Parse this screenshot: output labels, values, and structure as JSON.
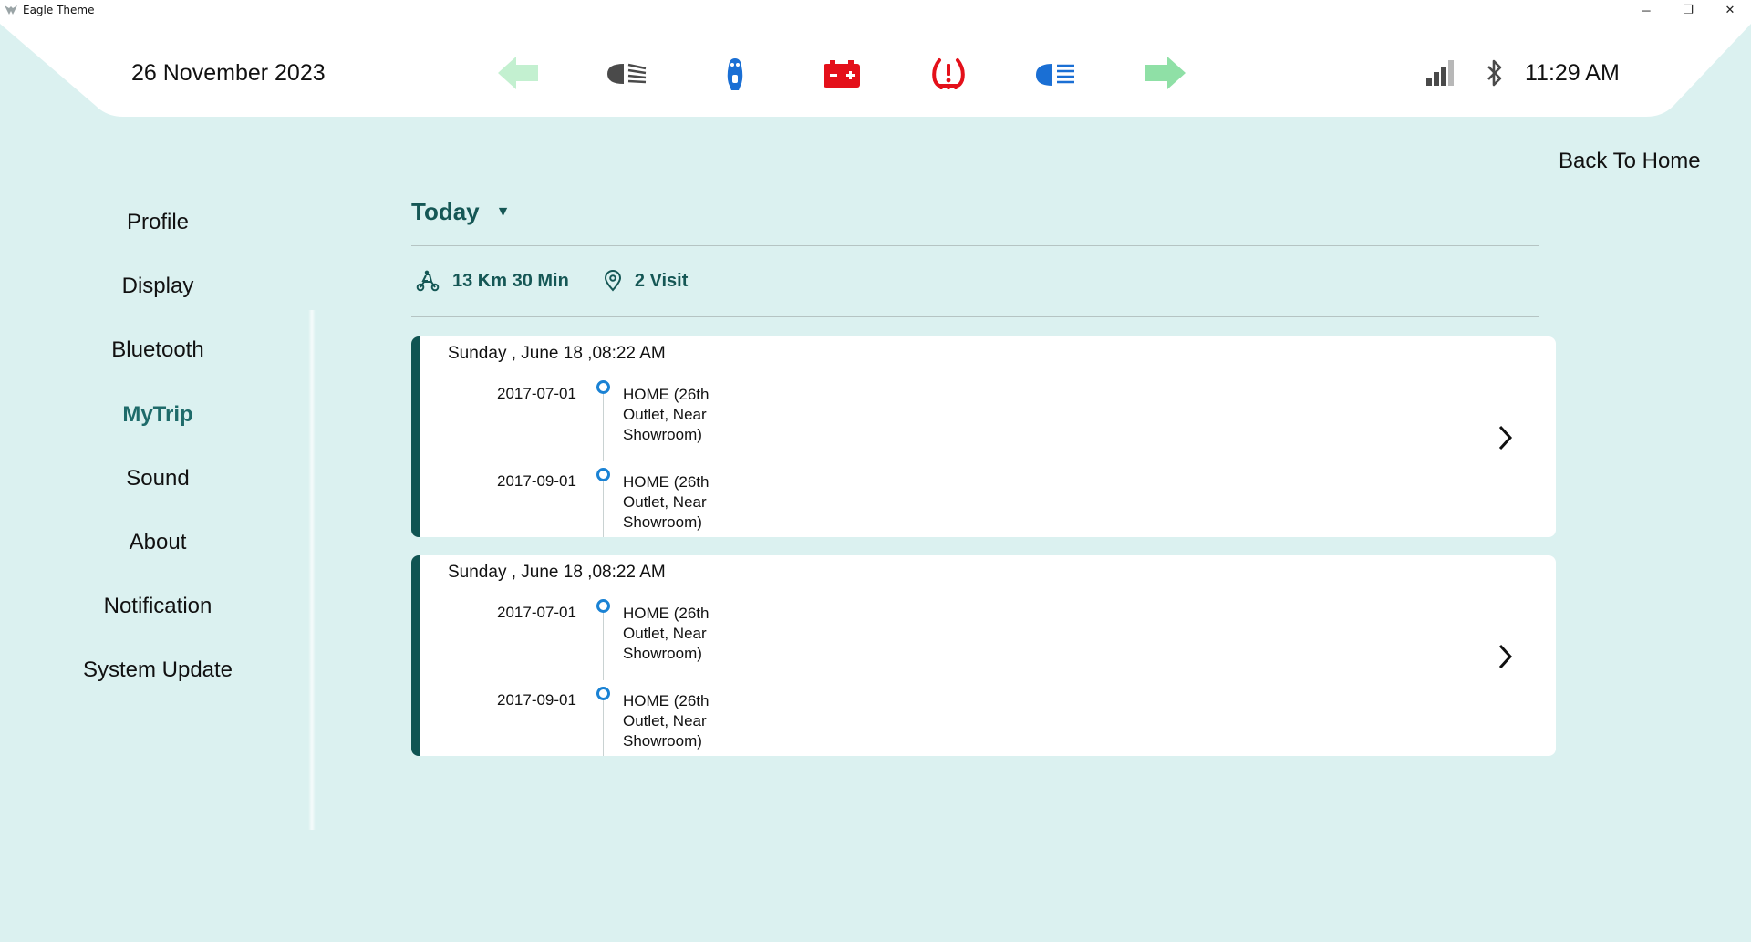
{
  "window": {
    "title": "Eagle Theme",
    "controls": {
      "minimize": "─",
      "maximize": "❐",
      "close": "✕"
    }
  },
  "status_bar": {
    "date": "26 November 2023",
    "time": "11:29 AM",
    "indicators": [
      {
        "name": "left-turn-signal-icon",
        "color": "#c3f0d0"
      },
      {
        "name": "low-beam-icon",
        "color": "#4a4a4a"
      },
      {
        "name": "side-stand-icon",
        "color": "#1a6fd4"
      },
      {
        "name": "battery-warning-icon",
        "color": "#e4101a"
      },
      {
        "name": "tire-pressure-warning-icon",
        "color": "#e4101a"
      },
      {
        "name": "high-beam-icon",
        "color": "#1a6fd4"
      },
      {
        "name": "right-turn-signal-icon",
        "color": "#8fe0a6"
      }
    ],
    "signal_icon": "signal-strength-icon",
    "bluetooth_icon": "bluetooth-icon"
  },
  "nav": {
    "back_home": "Back To Home"
  },
  "sidebar": {
    "items": [
      {
        "label": "Profile",
        "active": false
      },
      {
        "label": "Display",
        "active": false
      },
      {
        "label": "Bluetooth",
        "active": false
      },
      {
        "label": "MyTrip",
        "active": true
      },
      {
        "label": "Sound",
        "active": false
      },
      {
        "label": "About",
        "active": false
      },
      {
        "label": "Notification",
        "active": false
      },
      {
        "label": "System Update",
        "active": false
      }
    ]
  },
  "main": {
    "filter": {
      "selected": "Today",
      "caret": "▼"
    },
    "summary": {
      "distance_time": "13 Km 30 Min",
      "visits": "2 Visit"
    },
    "trips": [
      {
        "datetime": "Sunday , June 18 ,08:22 AM",
        "stops": [
          {
            "date": "2017-07-01",
            "place": "HOME (26th Outlet, Near Showroom)"
          },
          {
            "date": "2017-09-01",
            "place": "HOME (26th Outlet, Near Showroom)"
          }
        ]
      },
      {
        "datetime": "Sunday , June 18 ,08:22 AM",
        "stops": [
          {
            "date": "2017-07-01",
            "place": "HOME (26th Outlet, Near Showroom)"
          },
          {
            "date": "2017-09-01",
            "place": "HOME (26th Outlet, Near Showroom)"
          }
        ]
      }
    ]
  },
  "colors": {
    "background": "#dbf1f0",
    "accent": "#155755",
    "card_accent": "#0f5452",
    "timeline_dot": "#1a82d4",
    "active_nav": "#1e6b6a"
  }
}
